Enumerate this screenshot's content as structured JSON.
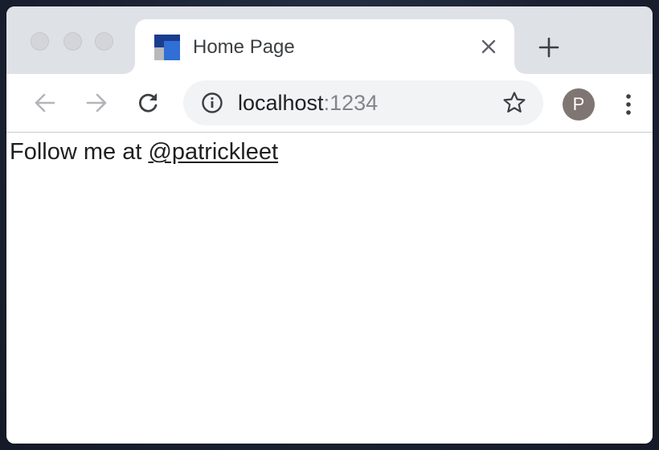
{
  "tab": {
    "title": "Home Page",
    "favicon_colors": [
      "#1a3c8f",
      "#2f6fd6",
      "#b9b9b9"
    ]
  },
  "toolbar": {
    "back_icon": "arrow-left-icon",
    "forward_icon": "arrow-right-icon",
    "reload_icon": "reload-icon"
  },
  "omnibox": {
    "host": "localhost",
    "port": ":1234",
    "info_icon": "info-icon",
    "bookmark_icon": "star-icon"
  },
  "profile": {
    "initial": "P",
    "color": "#7f7572"
  },
  "page": {
    "follow_text": "Follow me at ",
    "link_text": "@patrickleet"
  }
}
